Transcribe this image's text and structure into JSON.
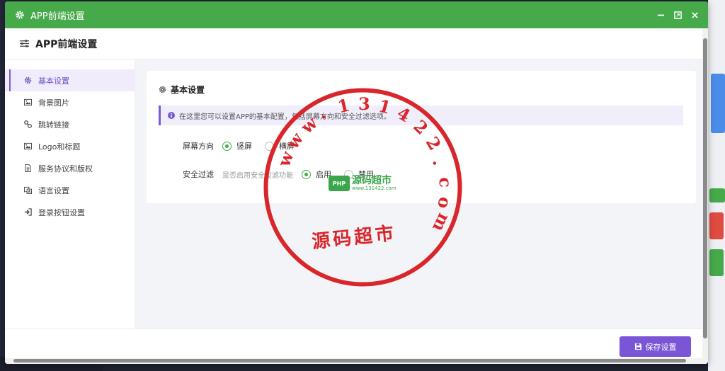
{
  "window": {
    "title": "APP前端设置",
    "accent": "#46a94a",
    "controls": [
      "minimize-icon",
      "maximize-icon",
      "close-icon"
    ]
  },
  "header": {
    "title": "APP前端设置",
    "icon": "sliders-icon"
  },
  "sidebar": {
    "items": [
      {
        "label": "基本设置",
        "icon": "gear-icon",
        "active": true
      },
      {
        "label": "背景图片",
        "icon": "image-icon"
      },
      {
        "label": "跳转链接",
        "icon": "link-icon"
      },
      {
        "label": "Logo和标题",
        "icon": "image-icon"
      },
      {
        "label": "服务协议和版权",
        "icon": "document-icon"
      },
      {
        "label": "语言设置",
        "icon": "language-icon"
      },
      {
        "label": "登录按钮设置",
        "icon": "sign-in-icon"
      }
    ]
  },
  "card": {
    "title": "基本设置",
    "notice": "在这里您可以设置APP的基本配置，包括屏幕方向和安全过滤选项。",
    "screen": {
      "label": "屏幕方向",
      "options": [
        "竖屏",
        "横屏"
      ],
      "selected": "竖屏"
    },
    "filter": {
      "label": "安全过滤",
      "hint": "是否启用安全过滤功能",
      "options": [
        "启用",
        "禁用"
      ],
      "selected": "启用"
    }
  },
  "footer": {
    "save_label": "保存设置",
    "save_color": "#7a56d6"
  },
  "watermark": {
    "ring_text": [
      "w",
      "w",
      "w",
      ".",
      "1",
      "3",
      "1",
      "4",
      "2",
      "2",
      ".",
      "c",
      "o",
      "m"
    ],
    "bottom_text": "源码超市",
    "badge": "PHP",
    "brand": "源码超市",
    "brand_sub": "www.131422.com",
    "color": "#d9262b"
  }
}
